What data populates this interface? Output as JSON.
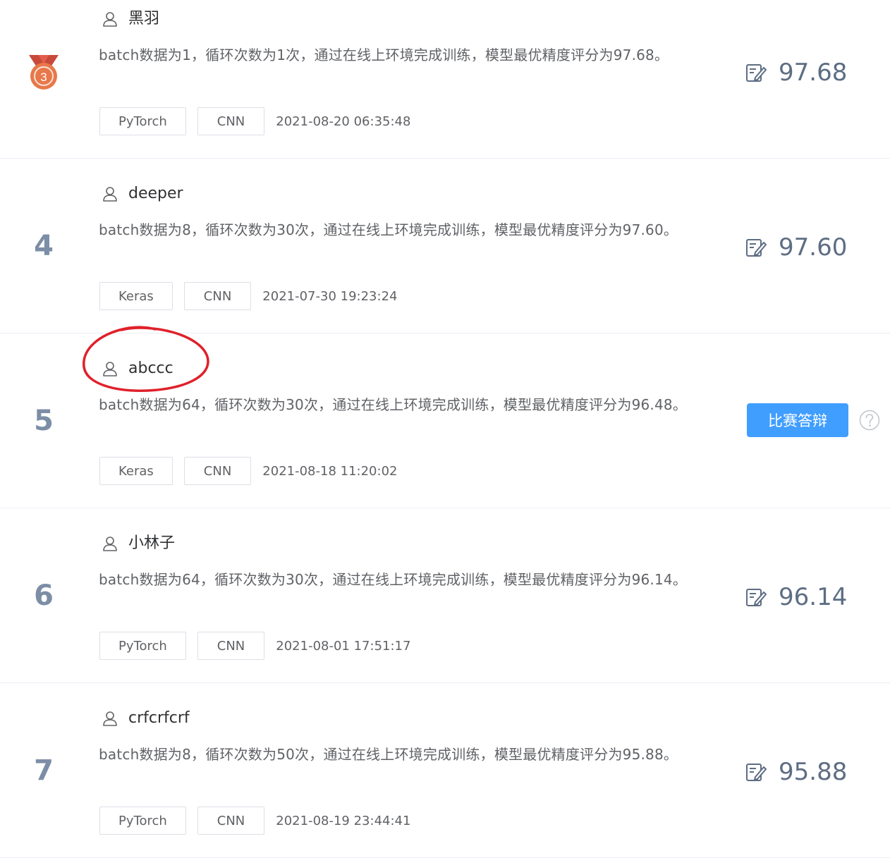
{
  "rows": [
    {
      "rank": "",
      "medal_label": "3",
      "username": "黑羽",
      "description": "batch数据为1，循环次数为1次，通过在线上环境完成训练，模型最优精度评分为97.68。",
      "framework": "PyTorch",
      "network": "CNN",
      "datetime": "2021-08-20 06:35:48",
      "score": "97.68"
    },
    {
      "rank": "4",
      "username": "deeper",
      "description": "batch数据为8，循环次数为30次，通过在线上环境完成训练，模型最优精度评分为97.60。",
      "framework": "Keras",
      "network": "CNN",
      "datetime": "2021-07-30 19:23:24",
      "score": "97.60"
    },
    {
      "rank": "5",
      "username": "abccc",
      "description": "batch数据为64，循环次数为30次，通过在线上环境完成训练，模型最优精度评分为96.48。",
      "framework": "Keras",
      "network": "CNN",
      "datetime": "2021-08-18 11:20:02",
      "defense_button": "比赛答辩"
    },
    {
      "rank": "6",
      "username": "小林子",
      "description": "batch数据为64，循环次数为30次，通过在线上环境完成训练，模型最优精度评分为96.14。",
      "framework": "PyTorch",
      "network": "CNN",
      "datetime": "2021-08-01 17:51:17",
      "score": "96.14"
    },
    {
      "rank": "7",
      "username": "crfcrfcrf",
      "description": "batch数据为8，循环次数为50次，通过在线上环境完成训练，模型最优精度评分为95.88。",
      "framework": "PyTorch",
      "network": "CNN",
      "datetime": "2021-08-19 23:44:41",
      "score": "95.88"
    }
  ],
  "colors": {
    "accent": "#409eff",
    "rank": "#7c8ea6",
    "medal": "#e8774a",
    "annotation": "#e0202a",
    "border": "#ebeef5"
  },
  "icons": {
    "user": "user-outline-icon",
    "score": "edit-note-icon",
    "help": "question-circle-icon",
    "medal": "bronze-medal-icon"
  }
}
